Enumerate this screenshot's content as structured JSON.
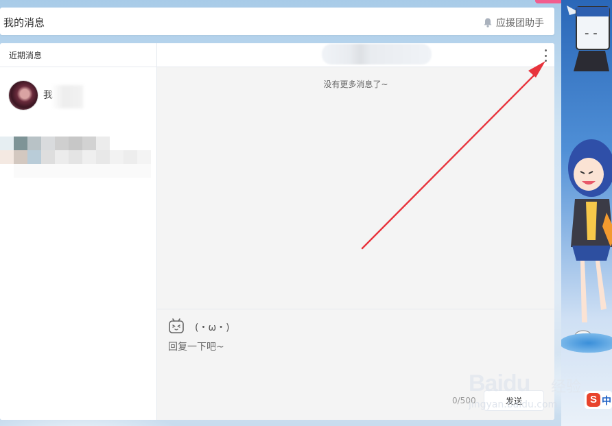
{
  "header": {
    "title": "我的消息",
    "helper_label": "应援团助手"
  },
  "sidebar": {
    "heading": "近期消息",
    "contacts": [
      {
        "name": "我"
      }
    ]
  },
  "chat": {
    "no_more": "没有更多消息了~",
    "emoji_label": "(・ω・)",
    "input_placeholder": "回复一下吧~",
    "char_count": "0/500",
    "send_label": "发送"
  },
  "watermark": {
    "brand": "Baidu",
    "brand_cn": "经验",
    "url": "jingyan.baidu.com"
  },
  "ad": {
    "logo_letter": "S",
    "logo_text": "中"
  },
  "colors": {
    "accent_pink": "#f25d8e",
    "annotation_red": "#e8333c"
  }
}
